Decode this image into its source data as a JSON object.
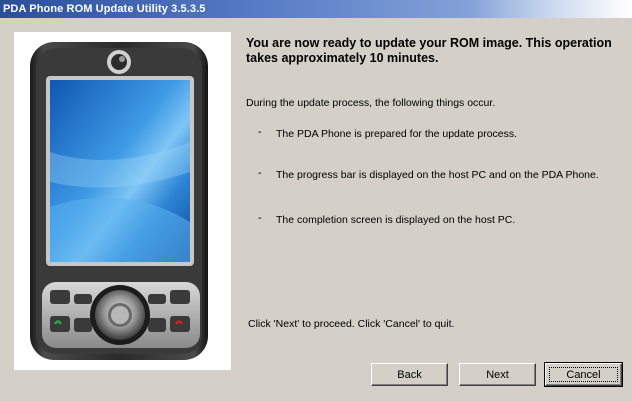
{
  "window": {
    "title": "PDA Phone ROM Update Utility 3.5.3.5"
  },
  "content": {
    "heading": "You are now ready to update your ROM image. This operation takes approximately 10 minutes.",
    "intro": "During the update process, the following things occur.",
    "bullet_marker": "-",
    "bullets": [
      "The PDA Phone is prepared for the update process.",
      "The progress bar is displayed on the host PC and on the PDA Phone.",
      "The completion screen is displayed on the host PC."
    ],
    "instruction": "Click 'Next' to proceed. Click 'Cancel' to quit."
  },
  "buttons": {
    "back": "Back",
    "next": "Next",
    "cancel": "Cancel"
  },
  "colors": {
    "title_bar_start": "#2a4e9c",
    "dialog_background": "#d4d0c8",
    "phone_screen": "#2f7fd0"
  },
  "image": {
    "description_icon": "pda-phone-device-icon"
  }
}
